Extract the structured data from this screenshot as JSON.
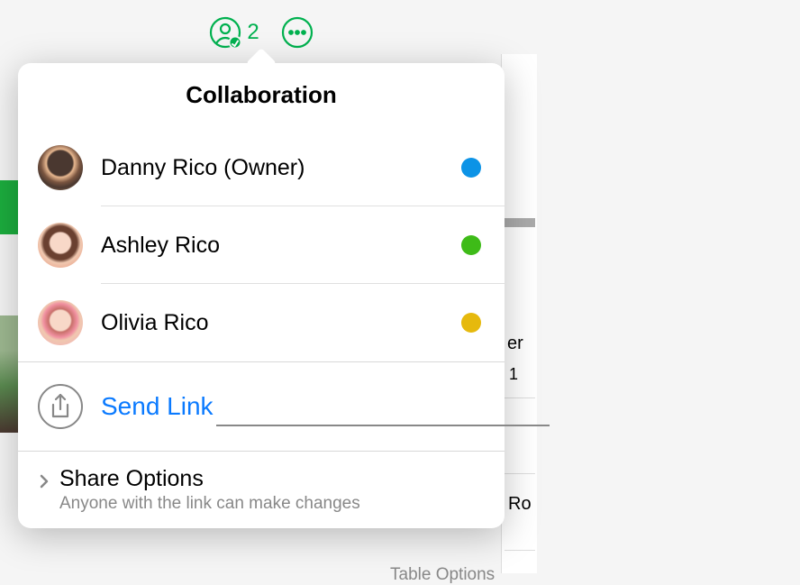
{
  "toolbar": {
    "collab_count": "2"
  },
  "popover": {
    "title": "Collaboration",
    "participants": [
      {
        "name": "Danny Rico (Owner)",
        "color": "blue"
      },
      {
        "name": "Ashley Rico",
        "color": "green"
      },
      {
        "name": "Olivia Rico",
        "color": "yellow"
      }
    ],
    "send_link_label": "Send Link",
    "share_options": {
      "title": "Share Options",
      "subtitle": "Anyone with the link can make changes"
    }
  },
  "background": {
    "text_frag_1": "er",
    "text_frag_2": "1",
    "text_frag_3": "Ro",
    "text_frag_4": "Table Options"
  }
}
